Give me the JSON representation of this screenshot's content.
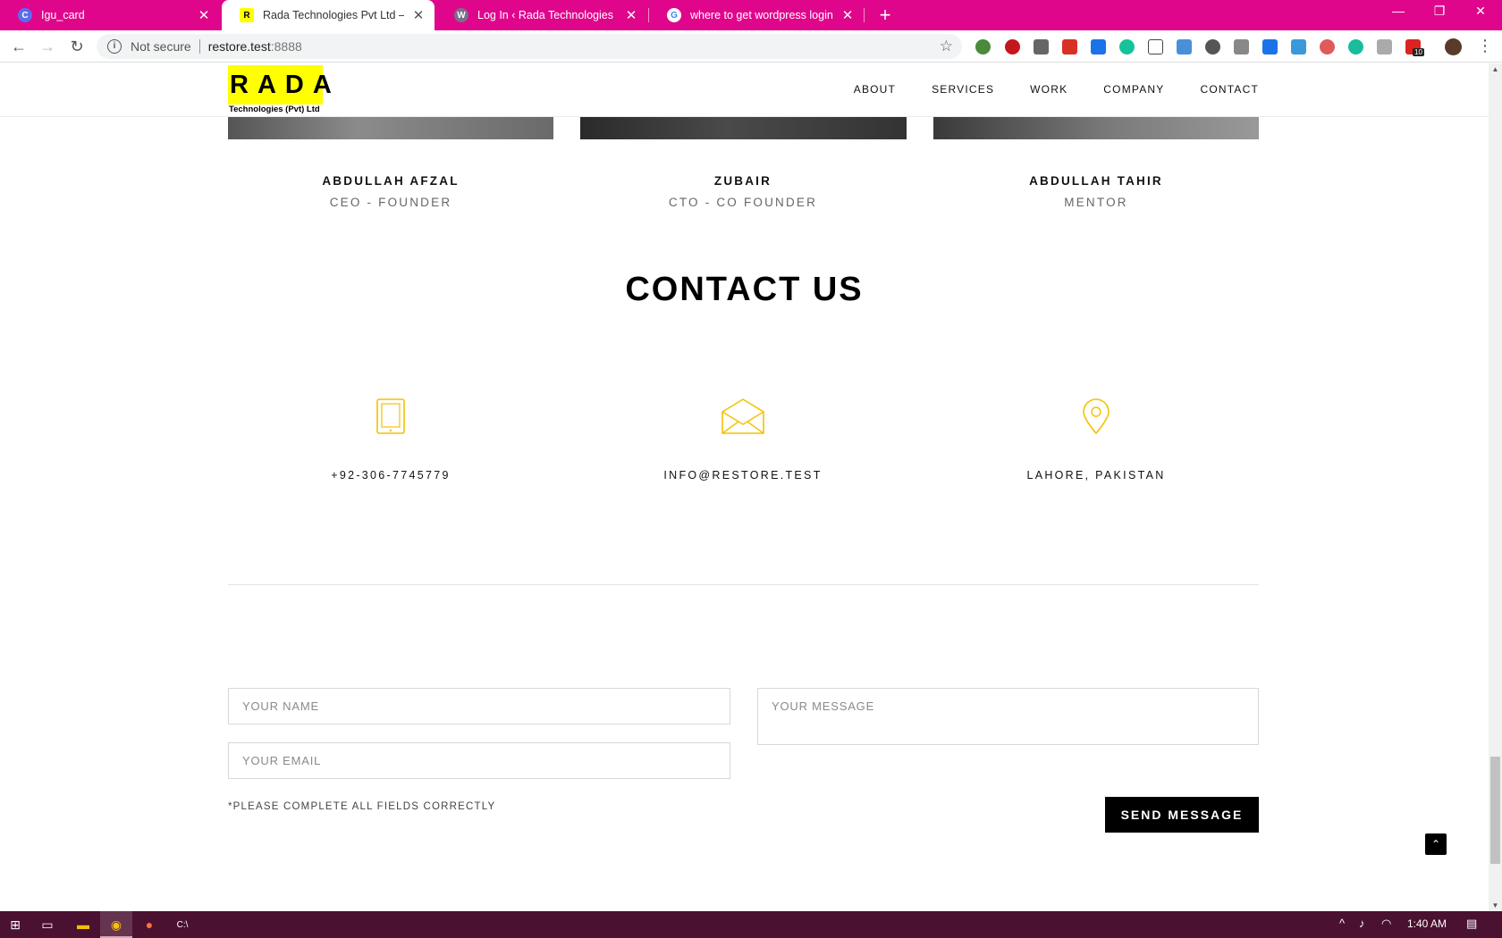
{
  "browser": {
    "tabs": [
      {
        "title": "Igu_card",
        "favicon": "c-circle-icon",
        "active": false
      },
      {
        "title": "Rada Technologies Pvt Ltd – Auto",
        "favicon": "r-logo-icon",
        "active": true
      },
      {
        "title": "Log In ‹ Rada Technologies Pvt Lt",
        "favicon": "wordpress-icon",
        "active": false
      },
      {
        "title": "where to get wordpress login pa",
        "favicon": "google-icon",
        "active": false
      }
    ],
    "address": {
      "security": "Not secure",
      "host": "restore.test",
      "port": ":8888"
    },
    "extension_badge": "10",
    "accent": "#e0068c"
  },
  "site": {
    "logo": {
      "mark": "RADA",
      "sub": "Technologies (Pvt) Ltd"
    },
    "nav": [
      "ABOUT",
      "SERVICES",
      "WORK",
      "COMPANY",
      "CONTACT"
    ],
    "team": [
      {
        "name": "ABDULLAH AFZAL",
        "role": "CEO - FOUNDER"
      },
      {
        "name": "ZUBAIR",
        "role": "CTO - CO FOUNDER"
      },
      {
        "name": "ABDULLAH TAHIR",
        "role": "MENTOR"
      }
    ],
    "contact_title": "CONTACT US",
    "contact_info": [
      {
        "icon": "tablet-icon",
        "value": "+92-306-7745779"
      },
      {
        "icon": "envelope-icon",
        "value": "INFO@RESTORE.TEST"
      },
      {
        "icon": "map-pin-icon",
        "value": "LAHORE, PAKISTAN"
      }
    ],
    "form": {
      "name_placeholder": "YOUR NAME",
      "email_placeholder": "YOUR EMAIL",
      "message_placeholder": "YOUR MESSAGE",
      "hint": "*PLEASE COMPLETE ALL FIELDS CORRECTLY",
      "submit_label": "SEND MESSAGE"
    },
    "icon_color": "#f2c200"
  },
  "taskbar": {
    "time": "1:40 AM"
  }
}
